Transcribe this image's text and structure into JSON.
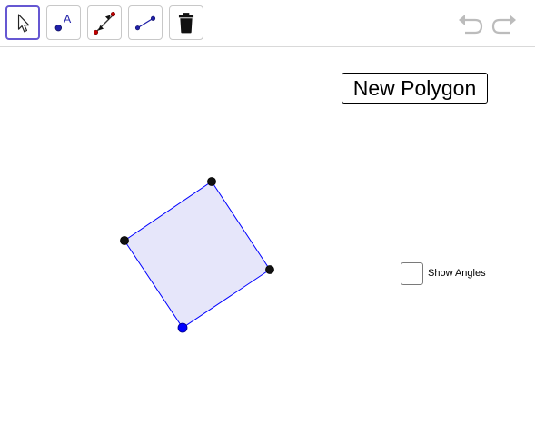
{
  "toolbar": {
    "tools": [
      {
        "id": "move",
        "icon": "arrow-cursor-icon",
        "selected": true
      },
      {
        "id": "point",
        "icon": "point-icon",
        "label": "A",
        "selected": false
      },
      {
        "id": "move-graphics",
        "icon": "move-graphics-icon",
        "selected": false
      },
      {
        "id": "segment",
        "icon": "segment-icon",
        "selected": false
      },
      {
        "id": "delete",
        "icon": "trash-icon",
        "selected": false
      }
    ],
    "undo_icon": "undo-icon",
    "redo_icon": "redo-icon"
  },
  "canvas": {
    "new_polygon_label": "New Polygon",
    "show_angles_label": "Show Angles",
    "show_angles_checked": false
  },
  "colors": {
    "selected_tool_border": "#6557d2",
    "polygon_stroke": "#0000ff",
    "polygon_fill": "#e6e6fa",
    "vertex_black": "#000000",
    "vertex_blue": "#0000ff",
    "icon_blue": "#2020a8",
    "icon_red": "#c00000",
    "undo_redo_gray": "#bcbcbc"
  }
}
